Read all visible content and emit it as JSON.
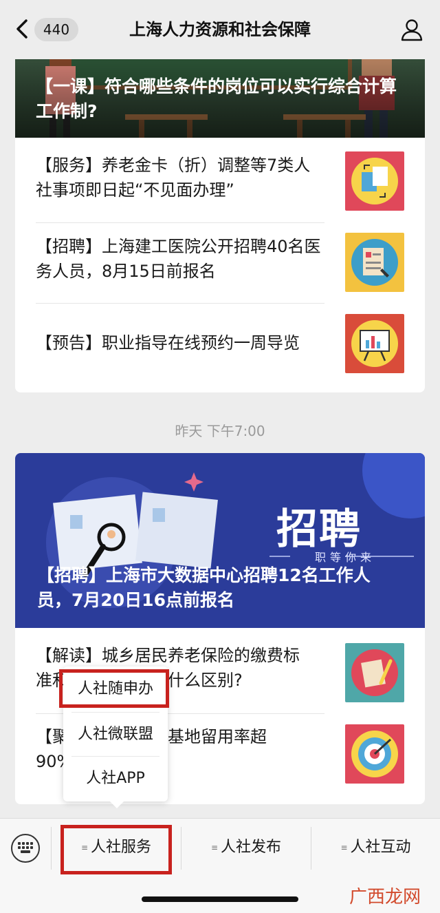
{
  "header": {
    "badge": "440",
    "title": "上海人力资源和社会保障"
  },
  "card1": {
    "banner_title": "【一课】符合哪些条件的岗位可以实行综合计算工作制?",
    "items": [
      {
        "text": "【服务】养老金卡（折）调整等7类人社事项即日起“不见面办理”",
        "thumb_bg": "#e0485a"
      },
      {
        "text": "【招聘】上海建工医院公开招聘40名医务人员，8月15日前报名",
        "thumb_bg": "#f3c23f"
      },
      {
        "text": "【预告】职业指导在线预约一周导览",
        "thumb_bg": "#d94c3a"
      }
    ]
  },
  "timestamp": "昨天 下午7:00",
  "card2": {
    "banner_big": "招聘",
    "banner_sub": "职等你来",
    "banner_title": "【招聘】上海市大数据中心招聘12名工作人员，7月20日16点前报名",
    "items": [
      {
        "text_line1": "【解读】城乡居民养老保险的缴费标",
        "text_line2": "准和…………少有什么区别?"
      },
      {
        "text_line1": "【聚…………见习基地留用率超",
        "text_line2": "90%"
      }
    ]
  },
  "popup": {
    "items": [
      "人社随申办",
      "人社微联盟",
      "人社APP"
    ]
  },
  "bottom_menu": {
    "tabs": [
      "人社服务",
      "人社发布",
      "人社互动"
    ]
  },
  "watermark": "广西龙网",
  "colors": {
    "highlight": "#c8221e",
    "banner2": "#2b3c9a"
  }
}
